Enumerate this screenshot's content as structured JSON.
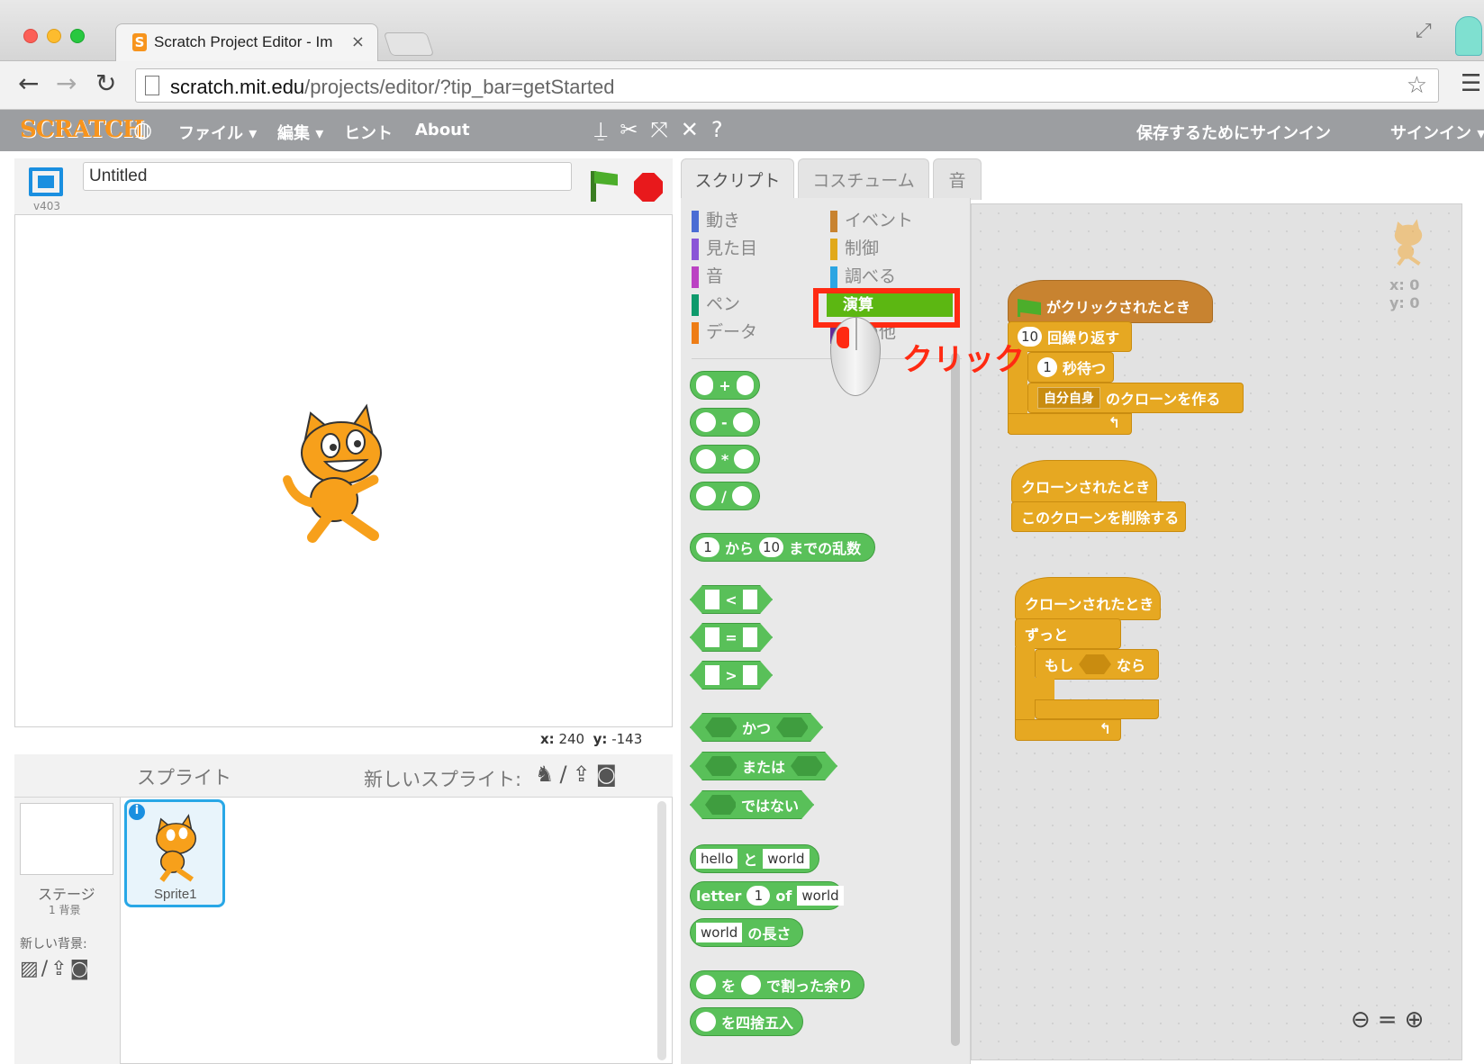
{
  "browser": {
    "tab_title": "Scratch Project Editor - Im",
    "tab_close": "×",
    "favicon": "S",
    "url_domain": "scratch.mit.edu",
    "url_path": "/projects/editor/?tip_bar=getStarted",
    "icons": [
      "back-icon",
      "forward-icon",
      "reload-icon",
      "page-icon",
      "star-icon",
      "menu-icon",
      "fullscreen-icon"
    ]
  },
  "menubar": {
    "logo": "SCRATCH",
    "file": "ファイル ▾",
    "edit": "編集 ▾",
    "hint": "ヒント",
    "about": "About",
    "save_signin": "保存するためにサインイン",
    "signin": "サインイン ▾",
    "tool_icons": [
      "duplicate-icon",
      "cut-icon",
      "grow-icon",
      "shrink-icon",
      "help-icon"
    ]
  },
  "stage": {
    "version": "v403",
    "title_value": "Untitled",
    "x_label": "x:",
    "x_value": "240",
    "y_label": "y:",
    "y_value": "-143"
  },
  "sprites": {
    "header": "スプライト",
    "new_sprite": "新しいスプライト:",
    "sprite_name": "Sprite1",
    "stage_label": "ステージ",
    "stage_sub": "1 背景",
    "new_backdrop": "新しい背景:"
  },
  "editor_tabs": [
    "スクリプト",
    "コスチューム",
    "音"
  ],
  "categories_left": [
    {
      "label": "動き",
      "color": "#4a6cd4"
    },
    {
      "label": "見た目",
      "color": "#8a55d7"
    },
    {
      "label": "音",
      "color": "#bb42c3"
    },
    {
      "label": "ペン",
      "color": "#0e9a6c"
    },
    {
      "label": "データ",
      "color": "#ee7d16"
    }
  ],
  "categories_right": [
    {
      "label": "イベント",
      "color": "#c88330"
    },
    {
      "label": "制御",
      "color": "#e1a91a"
    },
    {
      "label": "調べる",
      "color": "#2ca5e2"
    },
    {
      "label": "演算",
      "color": "#5cb712"
    },
    {
      "label": "その他",
      "color": "#632d99"
    }
  ],
  "operator_blocks": {
    "add": "+",
    "sub": "-",
    "mul": "*",
    "div": "/",
    "random_a": "1",
    "random_from": "から",
    "random_b": "10",
    "random_to": "までの乱数",
    "lt": "<",
    "eq": "=",
    "gt": ">",
    "and": "かつ",
    "or": "または",
    "not": "ではない",
    "join_a": "hello",
    "join": "と",
    "join_b": "world",
    "letter": "letter",
    "letter_n": "1",
    "of": "of",
    "letter_s": "world",
    "length_s": "world",
    "length": "の長さ",
    "mod_a": "を",
    "mod_b": "で割った余り",
    "round": "を四捨五入"
  },
  "scripts": {
    "flag_hat": "がクリックされたとき",
    "repeat_n": "10",
    "repeat": "回繰り返す",
    "wait_n": "1",
    "wait": "秒待つ",
    "clone_menu": "自分自身",
    "clone": "のクローンを作る",
    "clone_hat_1": "クローンされたとき",
    "delete_clone": "このクローンを削除する",
    "clone_hat_2": "クローンされたとき",
    "forever": "ずっと",
    "if": "もし",
    "then": "なら",
    "sprite_x": "x: 0",
    "sprite_y": "y: 0"
  },
  "annotation": {
    "click_label": "クリック"
  },
  "colors": {
    "operators": "#59c059",
    "control": "#e6a822",
    "highlight": "#ff2a12",
    "menubar": "#9c9ea1"
  }
}
